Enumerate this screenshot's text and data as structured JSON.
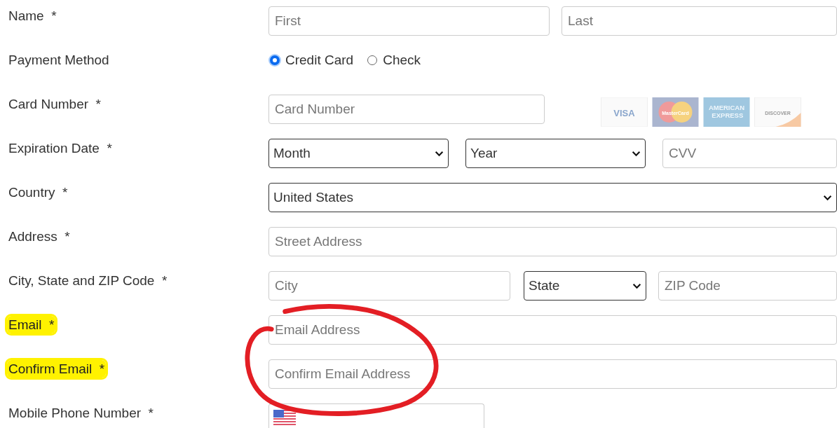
{
  "rows": [
    {
      "label": "Name",
      "mark": "*",
      "highlighted": false,
      "controls": [
        {
          "kind": "input",
          "placeholder": "First"
        },
        {
          "kind": "input",
          "placeholder": "Last"
        }
      ]
    },
    {
      "label": "Payment Method",
      "highlighted": false,
      "controls": [
        {
          "kind": "radios",
          "options": [
            {
              "label": "Credit Card",
              "selected": true
            },
            {
              "label": "Check",
              "selected": false
            }
          ]
        }
      ]
    },
    {
      "label": "Card Number",
      "mark": "*",
      "highlighted": false,
      "controls": [
        {
          "kind": "input",
          "placeholder": "Card Number"
        },
        {
          "kind": "cards",
          "logos": [
            {
              "kind": "visa",
              "text": "VISA"
            },
            {
              "kind": "mastercard",
              "text": "MasterCard"
            },
            {
              "kind": "amex",
              "text": "AMERICAN EXPRESS"
            },
            {
              "kind": "discover",
              "text": "DISCOVER"
            }
          ]
        }
      ]
    },
    {
      "label": "Expiration Date",
      "mark": "*",
      "highlighted": false,
      "controls": [
        {
          "kind": "select",
          "value": "Month"
        },
        {
          "kind": "select",
          "value": "Year"
        },
        {
          "kind": "input",
          "placeholder": "CVV"
        }
      ]
    },
    {
      "label": "Country",
      "mark": "*",
      "highlighted": false,
      "controls": [
        {
          "kind": "select",
          "value": "United States"
        }
      ]
    },
    {
      "label": "Address",
      "mark": "*",
      "highlighted": false,
      "controls": [
        {
          "kind": "input",
          "placeholder": "Street Address"
        }
      ]
    },
    {
      "label": "City, State and ZIP Code",
      "mark": "*",
      "highlighted": false,
      "controls": [
        {
          "kind": "input",
          "placeholder": "City"
        },
        {
          "kind": "select",
          "value": "State"
        },
        {
          "kind": "input",
          "placeholder": "ZIP Code"
        }
      ]
    },
    {
      "label": "Email",
      "mark": "*",
      "highlighted": true,
      "controls": [
        {
          "kind": "input",
          "placeholder": "Email Address"
        }
      ]
    },
    {
      "label": "Confirm Email",
      "mark": "*",
      "highlighted": true,
      "controls": [
        {
          "kind": "input",
          "placeholder": "Confirm Email Address"
        }
      ]
    },
    {
      "label": "Mobile Phone Number",
      "mark": "*",
      "highlighted": false,
      "controls": [
        {
          "kind": "phone"
        }
      ]
    }
  ],
  "annotation": {
    "kind": "circle"
  }
}
